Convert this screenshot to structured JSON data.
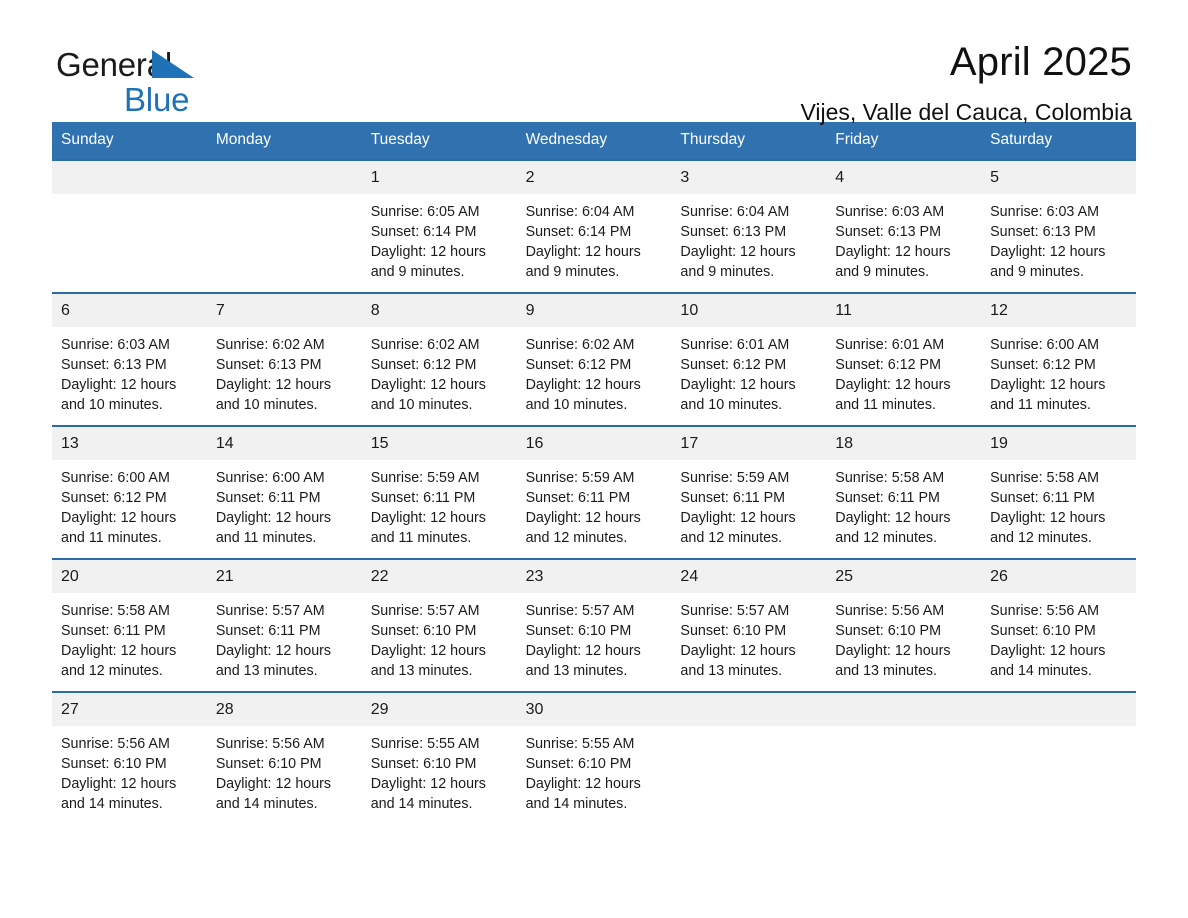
{
  "brand": {
    "line1": "General",
    "line2": "Blue",
    "accent_color": "#1f72b8"
  },
  "header": {
    "title": "April 2025",
    "subtitle": "Vijes, Valle del Cauca, Colombia"
  },
  "colors": {
    "header_blue": "#3071b0",
    "row_border_blue": "#2a6bab",
    "date_band": "#f1f1f1",
    "text": "#1b1b1b"
  },
  "weekdays": [
    "Sunday",
    "Monday",
    "Tuesday",
    "Wednesday",
    "Thursday",
    "Friday",
    "Saturday"
  ],
  "weeks": [
    {
      "dates": [
        "",
        "",
        "1",
        "2",
        "3",
        "4",
        "5"
      ],
      "cells": [
        {
          "empty": true
        },
        {
          "empty": true
        },
        {
          "empty": false,
          "sunrise": "Sunrise: 6:05 AM",
          "sunset": "Sunset: 6:14 PM",
          "daylight1": "Daylight: 12 hours",
          "daylight2": "and 9 minutes."
        },
        {
          "empty": false,
          "sunrise": "Sunrise: 6:04 AM",
          "sunset": "Sunset: 6:14 PM",
          "daylight1": "Daylight: 12 hours",
          "daylight2": "and 9 minutes."
        },
        {
          "empty": false,
          "sunrise": "Sunrise: 6:04 AM",
          "sunset": "Sunset: 6:13 PM",
          "daylight1": "Daylight: 12 hours",
          "daylight2": "and 9 minutes."
        },
        {
          "empty": false,
          "sunrise": "Sunrise: 6:03 AM",
          "sunset": "Sunset: 6:13 PM",
          "daylight1": "Daylight: 12 hours",
          "daylight2": "and 9 minutes."
        },
        {
          "empty": false,
          "sunrise": "Sunrise: 6:03 AM",
          "sunset": "Sunset: 6:13 PM",
          "daylight1": "Daylight: 12 hours",
          "daylight2": "and 9 minutes."
        }
      ]
    },
    {
      "dates": [
        "6",
        "7",
        "8",
        "9",
        "10",
        "11",
        "12"
      ],
      "cells": [
        {
          "empty": false,
          "sunrise": "Sunrise: 6:03 AM",
          "sunset": "Sunset: 6:13 PM",
          "daylight1": "Daylight: 12 hours",
          "daylight2": "and 10 minutes."
        },
        {
          "empty": false,
          "sunrise": "Sunrise: 6:02 AM",
          "sunset": "Sunset: 6:13 PM",
          "daylight1": "Daylight: 12 hours",
          "daylight2": "and 10 minutes."
        },
        {
          "empty": false,
          "sunrise": "Sunrise: 6:02 AM",
          "sunset": "Sunset: 6:12 PM",
          "daylight1": "Daylight: 12 hours",
          "daylight2": "and 10 minutes."
        },
        {
          "empty": false,
          "sunrise": "Sunrise: 6:02 AM",
          "sunset": "Sunset: 6:12 PM",
          "daylight1": "Daylight: 12 hours",
          "daylight2": "and 10 minutes."
        },
        {
          "empty": false,
          "sunrise": "Sunrise: 6:01 AM",
          "sunset": "Sunset: 6:12 PM",
          "daylight1": "Daylight: 12 hours",
          "daylight2": "and 10 minutes."
        },
        {
          "empty": false,
          "sunrise": "Sunrise: 6:01 AM",
          "sunset": "Sunset: 6:12 PM",
          "daylight1": "Daylight: 12 hours",
          "daylight2": "and 11 minutes."
        },
        {
          "empty": false,
          "sunrise": "Sunrise: 6:00 AM",
          "sunset": "Sunset: 6:12 PM",
          "daylight1": "Daylight: 12 hours",
          "daylight2": "and 11 minutes."
        }
      ]
    },
    {
      "dates": [
        "13",
        "14",
        "15",
        "16",
        "17",
        "18",
        "19"
      ],
      "cells": [
        {
          "empty": false,
          "sunrise": "Sunrise: 6:00 AM",
          "sunset": "Sunset: 6:12 PM",
          "daylight1": "Daylight: 12 hours",
          "daylight2": "and 11 minutes."
        },
        {
          "empty": false,
          "sunrise": "Sunrise: 6:00 AM",
          "sunset": "Sunset: 6:11 PM",
          "daylight1": "Daylight: 12 hours",
          "daylight2": "and 11 minutes."
        },
        {
          "empty": false,
          "sunrise": "Sunrise: 5:59 AM",
          "sunset": "Sunset: 6:11 PM",
          "daylight1": "Daylight: 12 hours",
          "daylight2": "and 11 minutes."
        },
        {
          "empty": false,
          "sunrise": "Sunrise: 5:59 AM",
          "sunset": "Sunset: 6:11 PM",
          "daylight1": "Daylight: 12 hours",
          "daylight2": "and 12 minutes."
        },
        {
          "empty": false,
          "sunrise": "Sunrise: 5:59 AM",
          "sunset": "Sunset: 6:11 PM",
          "daylight1": "Daylight: 12 hours",
          "daylight2": "and 12 minutes."
        },
        {
          "empty": false,
          "sunrise": "Sunrise: 5:58 AM",
          "sunset": "Sunset: 6:11 PM",
          "daylight1": "Daylight: 12 hours",
          "daylight2": "and 12 minutes."
        },
        {
          "empty": false,
          "sunrise": "Sunrise: 5:58 AM",
          "sunset": "Sunset: 6:11 PM",
          "daylight1": "Daylight: 12 hours",
          "daylight2": "and 12 minutes."
        }
      ]
    },
    {
      "dates": [
        "20",
        "21",
        "22",
        "23",
        "24",
        "25",
        "26"
      ],
      "cells": [
        {
          "empty": false,
          "sunrise": "Sunrise: 5:58 AM",
          "sunset": "Sunset: 6:11 PM",
          "daylight1": "Daylight: 12 hours",
          "daylight2": "and 12 minutes."
        },
        {
          "empty": false,
          "sunrise": "Sunrise: 5:57 AM",
          "sunset": "Sunset: 6:11 PM",
          "daylight1": "Daylight: 12 hours",
          "daylight2": "and 13 minutes."
        },
        {
          "empty": false,
          "sunrise": "Sunrise: 5:57 AM",
          "sunset": "Sunset: 6:10 PM",
          "daylight1": "Daylight: 12 hours",
          "daylight2": "and 13 minutes."
        },
        {
          "empty": false,
          "sunrise": "Sunrise: 5:57 AM",
          "sunset": "Sunset: 6:10 PM",
          "daylight1": "Daylight: 12 hours",
          "daylight2": "and 13 minutes."
        },
        {
          "empty": false,
          "sunrise": "Sunrise: 5:57 AM",
          "sunset": "Sunset: 6:10 PM",
          "daylight1": "Daylight: 12 hours",
          "daylight2": "and 13 minutes."
        },
        {
          "empty": false,
          "sunrise": "Sunrise: 5:56 AM",
          "sunset": "Sunset: 6:10 PM",
          "daylight1": "Daylight: 12 hours",
          "daylight2": "and 13 minutes."
        },
        {
          "empty": false,
          "sunrise": "Sunrise: 5:56 AM",
          "sunset": "Sunset: 6:10 PM",
          "daylight1": "Daylight: 12 hours",
          "daylight2": "and 14 minutes."
        }
      ]
    },
    {
      "dates": [
        "27",
        "28",
        "29",
        "30",
        "",
        "",
        ""
      ],
      "cells": [
        {
          "empty": false,
          "sunrise": "Sunrise: 5:56 AM",
          "sunset": "Sunset: 6:10 PM",
          "daylight1": "Daylight: 12 hours",
          "daylight2": "and 14 minutes."
        },
        {
          "empty": false,
          "sunrise": "Sunrise: 5:56 AM",
          "sunset": "Sunset: 6:10 PM",
          "daylight1": "Daylight: 12 hours",
          "daylight2": "and 14 minutes."
        },
        {
          "empty": false,
          "sunrise": "Sunrise: 5:55 AM",
          "sunset": "Sunset: 6:10 PM",
          "daylight1": "Daylight: 12 hours",
          "daylight2": "and 14 minutes."
        },
        {
          "empty": false,
          "sunrise": "Sunrise: 5:55 AM",
          "sunset": "Sunset: 6:10 PM",
          "daylight1": "Daylight: 12 hours",
          "daylight2": "and 14 minutes."
        },
        {
          "empty": true
        },
        {
          "empty": true
        },
        {
          "empty": true
        }
      ]
    }
  ]
}
